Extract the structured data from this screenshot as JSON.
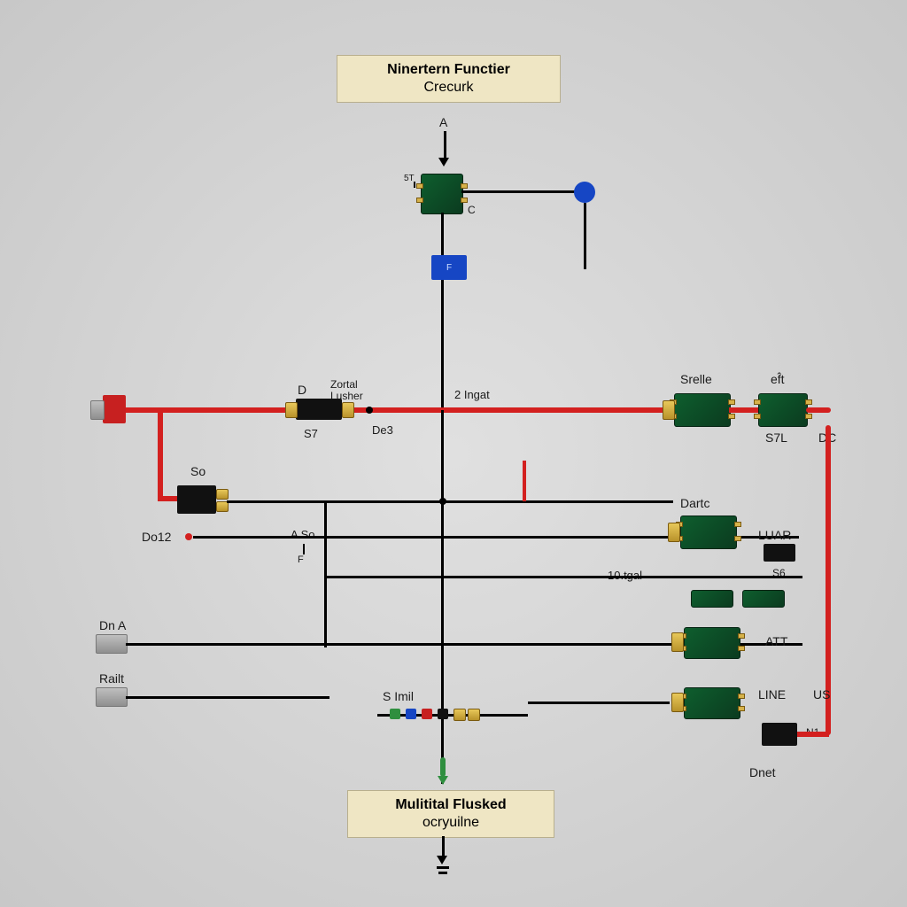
{
  "titleTop1": "Ninertern Functier",
  "titleTop2": "Crecurk",
  "titleBottom1": "Mulitital Flusked",
  "titleBottom2": "ocryuilne",
  "labels": {
    "A": "A",
    "C": "C",
    "ST_top": "5T",
    "F": "F",
    "D": "D",
    "ZortalLusher1": "Zortal",
    "ZortalLusher2": "Lusher",
    "TwoIngat": "2 Ingat",
    "S7": "S7",
    "De3": "De3",
    "So": "So",
    "Do12": "Do12",
    "ASo": "A So",
    "F2": "F",
    "DnA": "Dn A",
    "Railt": "Railt",
    "SImil": "S Imil",
    "Srelle": "Srelle",
    "Seft": "ef̂t",
    "S7L": "S7L",
    "DC": "DC",
    "Dartc": "Dartc",
    "LUAR": "LUAR",
    "S6": "S6",
    "tenTgal": "10.tgal",
    "ATT": "ATT",
    "LINE": "LINE",
    "US": "US",
    "N1": "N1",
    "Dnet": "Dnet"
  }
}
